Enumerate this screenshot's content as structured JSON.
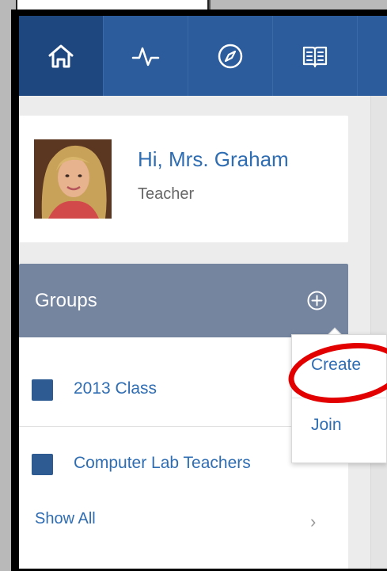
{
  "nav": {
    "tabs": [
      {
        "name": "home",
        "icon": "home-icon",
        "active": true
      },
      {
        "name": "activity",
        "icon": "pulse-icon",
        "active": false
      },
      {
        "name": "discover",
        "icon": "compass-icon",
        "active": false
      },
      {
        "name": "library",
        "icon": "book-icon",
        "active": false
      }
    ]
  },
  "profile": {
    "greeting": "Hi, Mrs. Graham",
    "role": "Teacher"
  },
  "groups": {
    "title": "Groups",
    "items": [
      {
        "label": "2013 Class",
        "color": "#2d5b92"
      },
      {
        "label": "Computer Lab Teachers",
        "color": "#2d5b92"
      }
    ],
    "show_all": "Show All"
  },
  "popup_menu": {
    "create_label": "Create",
    "join_label": "Join"
  },
  "colors": {
    "nav_bar": "#2c5c9c",
    "groups_header": "#7585a0",
    "link": "#2f6db3",
    "highlight": "#e30000"
  }
}
